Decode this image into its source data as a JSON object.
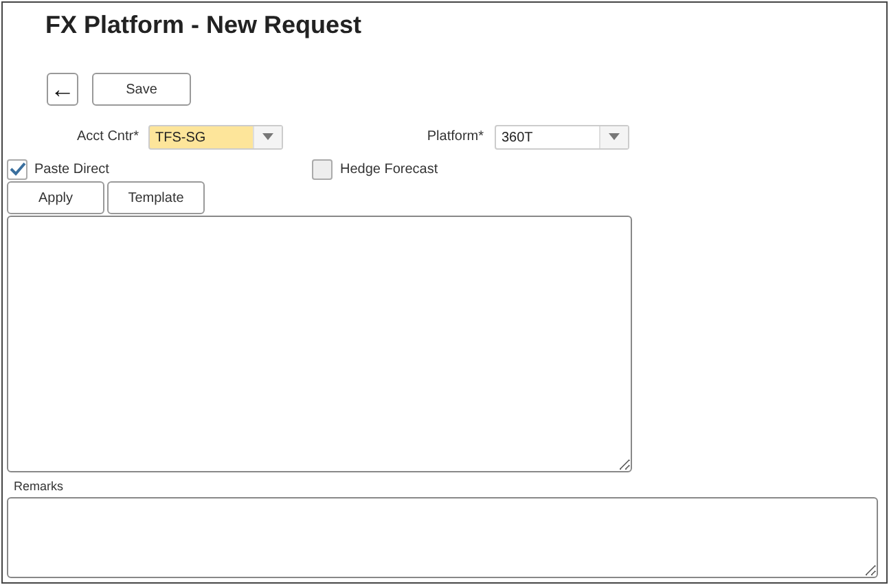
{
  "title": "FX Platform - New Request",
  "toolbar": {
    "back_button": "←",
    "save_button": "Save"
  },
  "fields": [
    {
      "label": "Acct Cntr*",
      "value": "TFS-SG",
      "focused": true
    },
    {
      "label": "Platform*",
      "value": "360T",
      "focused": false
    }
  ],
  "checkboxes": [
    {
      "label": "Paste Direct",
      "checked": true
    },
    {
      "label": "Hedge Forecast",
      "checked": false
    }
  ],
  "buttons": [
    "Apply",
    "Template"
  ],
  "remarks": {
    "label": "Remarks"
  }
}
